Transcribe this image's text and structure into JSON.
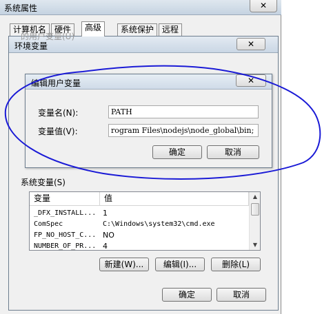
{
  "sysprops": {
    "title": "系统属性",
    "close": "✕",
    "tabs": [
      "计算机名",
      "硬件",
      "高级",
      "系统保护",
      "远程"
    ],
    "active_tab": "高级"
  },
  "env": {
    "title": "环境变量",
    "close": "✕",
    "user_vars_label": "的用户变量(U)",
    "ok": "确定",
    "cancel": "取消"
  },
  "edit": {
    "title": "编辑用户变量",
    "close": "✕",
    "name_label": "变量名(N):",
    "name_value": "PATH",
    "value_label": "变量值(V):",
    "value_value": "rogram Files\\nodejs\\node_global\\bin;",
    "ok": "确定",
    "cancel": "取消"
  },
  "sysvars": {
    "label": "系统变量(S)",
    "headers": [
      "变量",
      "值"
    ],
    "rows": [
      {
        "name": "_DFX_INSTALL...",
        "value": "1"
      },
      {
        "name": "ComSpec",
        "value": "C:\\Windows\\system32\\cmd.exe"
      },
      {
        "name": "FP_NO_HOST_C...",
        "value": "NO"
      },
      {
        "name": "NUMBER_OF_PR...",
        "value": "4"
      }
    ],
    "new_button": "新建(W)...",
    "edit_button": "编辑(I)...",
    "delete_button": "删除(L)"
  },
  "colors": {
    "annotation": "#1a1ad6",
    "titlebar": "#cad7e5"
  }
}
